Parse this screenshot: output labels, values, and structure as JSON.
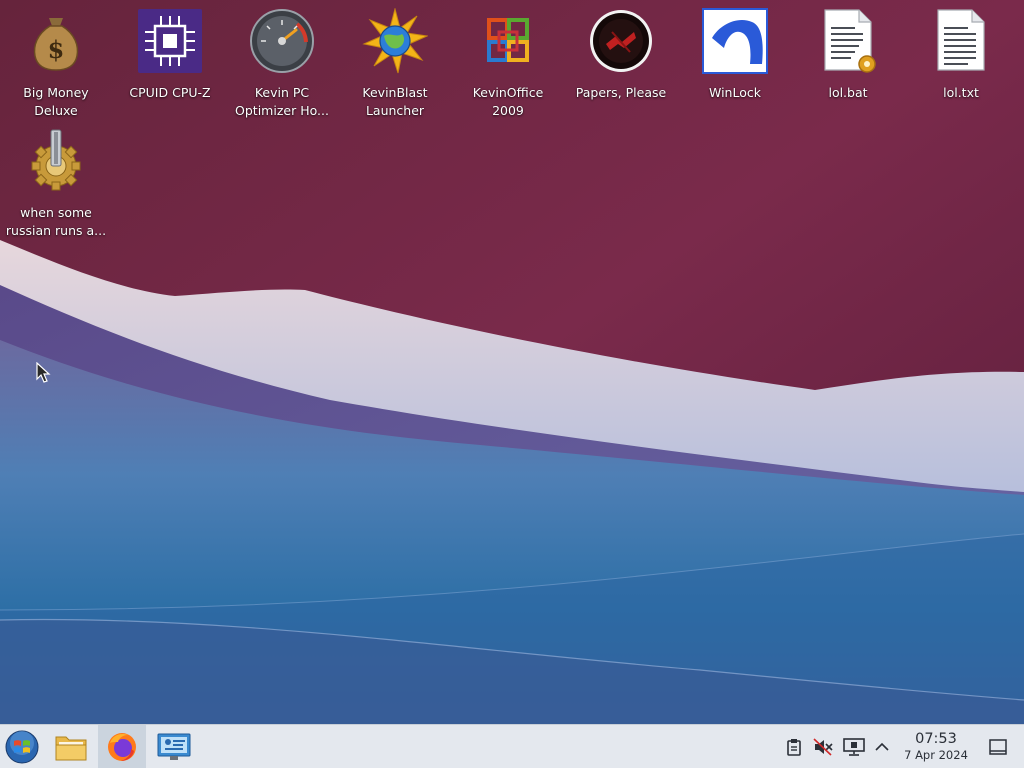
{
  "desktop": {
    "icons": [
      {
        "name": "big-money-deluxe",
        "label": "Big Money\nDeluxe",
        "icon": "money-bag-icon"
      },
      {
        "name": "cpuid-cpu-z",
        "label": "CPUID CPU-Z",
        "icon": "cpu-chip-icon"
      },
      {
        "name": "kevin-pc-optimizer",
        "label": "Kevin PC\nOptimizer Ho...",
        "icon": "speedometer-icon"
      },
      {
        "name": "kevinblast-launcher",
        "label": "KevinBlast\nLauncher",
        "icon": "globe-starburst-icon"
      },
      {
        "name": "kevinoffice-2009",
        "label": "KevinOffice\n2009",
        "icon": "office-logo-icon"
      },
      {
        "name": "papers-please",
        "label": "Papers, Please",
        "icon": "papers-please-seal-icon"
      },
      {
        "name": "winlock",
        "label": "WinLock",
        "icon": "winlock-icon"
      },
      {
        "name": "lol-bat",
        "label": "lol.bat",
        "icon": "batch-file-icon"
      },
      {
        "name": "lol-txt",
        "label": "lol.txt",
        "icon": "text-file-icon"
      },
      {
        "name": "when-some-russian",
        "label": "when some\nrussian runs a...",
        "icon": "gear-executable-icon"
      }
    ]
  },
  "taskbar": {
    "start": {
      "icon": "start-orb-icon"
    },
    "apps": [
      {
        "name": "file-manager",
        "icon": "folder-icon",
        "active": false
      },
      {
        "name": "firefox",
        "icon": "firefox-icon",
        "active": true
      },
      {
        "name": "remote-desktop",
        "icon": "remote-desktop-icon",
        "active": false
      }
    ],
    "tray": [
      {
        "name": "clipboard",
        "icon": "clipboard-icon"
      },
      {
        "name": "volume-muted",
        "icon": "volume-muted-icon"
      },
      {
        "name": "network",
        "icon": "network-monitor-icon"
      },
      {
        "name": "show-hidden",
        "icon": "chevron-up-icon"
      }
    ],
    "clock": {
      "time": "07:53",
      "date": "7 Apr 2024"
    },
    "show_desktop": {
      "icon": "show-desktop-icon"
    }
  },
  "colors": {
    "wallpaper_top": "#7a2a4a",
    "wallpaper_bottom": "#2a6aa0",
    "taskbar": "#e4e8ee"
  }
}
